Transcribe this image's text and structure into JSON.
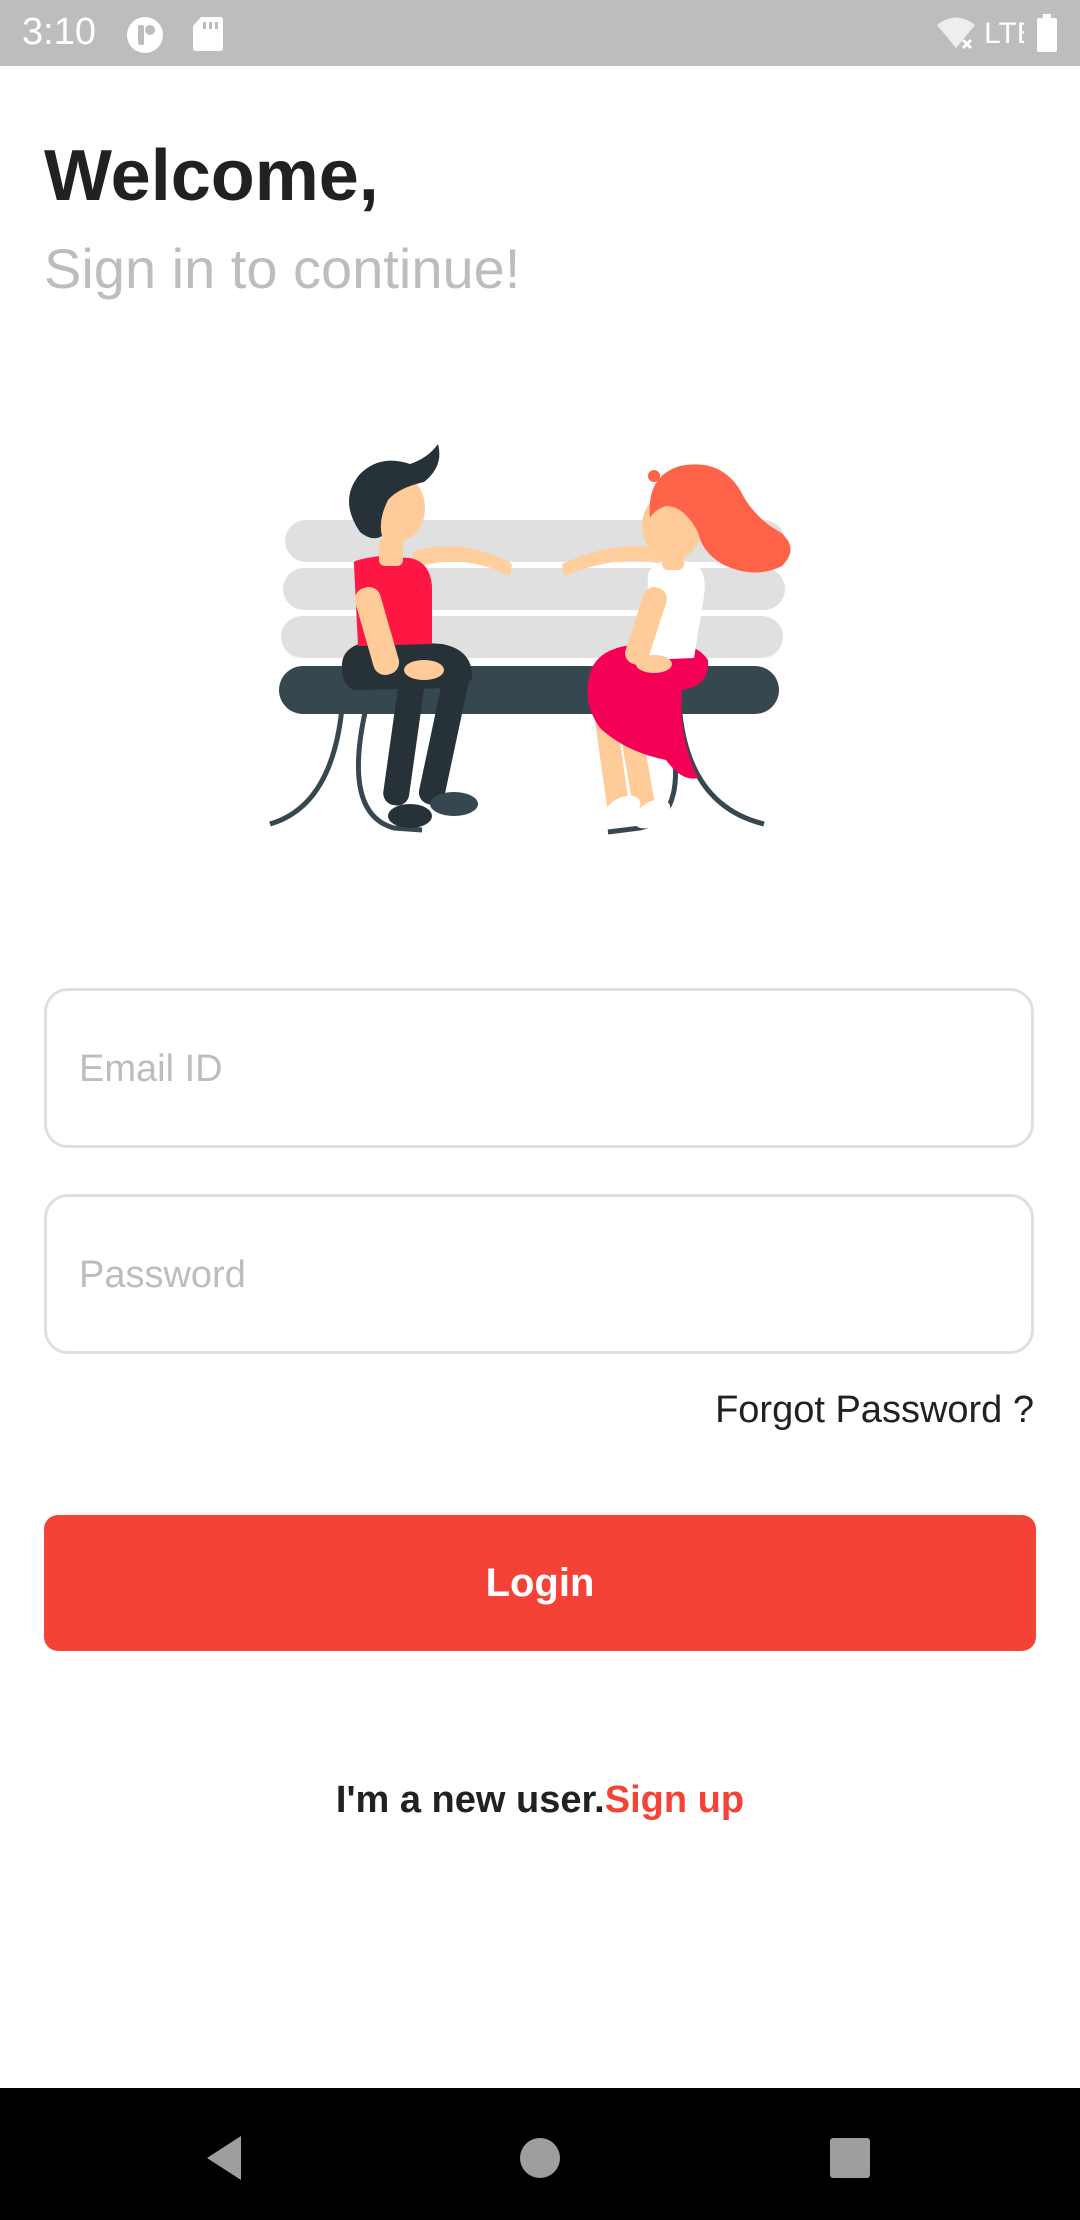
{
  "status_bar": {
    "time": "3:10",
    "network": "LTE"
  },
  "header": {
    "title": "Welcome,",
    "subtitle": "Sign in to continue!"
  },
  "form": {
    "email_placeholder": "Email ID",
    "email_value": "",
    "password_placeholder": "Password",
    "password_value": "",
    "forgot_password_label": "Forgot Password ?",
    "login_label": "Login"
  },
  "footer": {
    "new_user_prompt": "I'm a new user.",
    "signup_label": "Sign up"
  },
  "icons": {
    "status_left": [
      "notification-icon",
      "sd-card-icon"
    ],
    "status_right": [
      "wifi-off-icon",
      "lte-signal-icon",
      "battery-icon"
    ],
    "nav": [
      "back-icon",
      "home-icon",
      "recents-icon"
    ]
  },
  "colors": {
    "accent": "#f44336",
    "title": "#212121",
    "subtitle": "#bdbdbd",
    "field_border": "#e0e0e0",
    "status_bar": "#bdbdbd",
    "nav_bar": "#000000"
  }
}
